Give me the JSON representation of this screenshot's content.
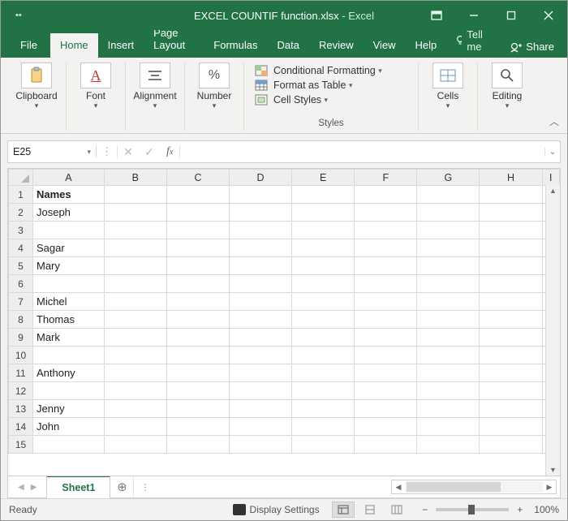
{
  "titlebar": {
    "document": "EXCEL COUNTIF function.xlsx",
    "app": "Excel"
  },
  "tabs": [
    "File",
    "Home",
    "Insert",
    "Page Layout",
    "Formulas",
    "Data",
    "Review",
    "View",
    "Help"
  ],
  "tell_me": "Tell me",
  "share": "Share",
  "ribbon": {
    "clipboard": {
      "label": "Clipboard"
    },
    "font": {
      "label": "Font"
    },
    "alignment": {
      "label": "Alignment"
    },
    "number": {
      "label": "Number"
    },
    "styles": {
      "conditional": "Conditional Formatting",
      "table": "Format as Table",
      "cell": "Cell Styles",
      "group_label": "Styles"
    },
    "cells": {
      "label": "Cells"
    },
    "editing": {
      "label": "Editing"
    }
  },
  "formula_bar": {
    "cell_ref": "E25",
    "formula": ""
  },
  "grid": {
    "columns": [
      "A",
      "B",
      "C",
      "D",
      "E",
      "F",
      "G",
      "H",
      "I"
    ],
    "rows": [
      {
        "n": 1,
        "A": "Names",
        "bold": true
      },
      {
        "n": 2,
        "A": "Joseph"
      },
      {
        "n": 3,
        "A": ""
      },
      {
        "n": 4,
        "A": "Sagar"
      },
      {
        "n": 5,
        "A": "Mary"
      },
      {
        "n": 6,
        "A": ""
      },
      {
        "n": 7,
        "A": "Michel"
      },
      {
        "n": 8,
        "A": "Thomas"
      },
      {
        "n": 9,
        "A": "Mark"
      },
      {
        "n": 10,
        "A": ""
      },
      {
        "n": 11,
        "A": "Anthony"
      },
      {
        "n": 12,
        "A": ""
      },
      {
        "n": 13,
        "A": "Jenny"
      },
      {
        "n": 14,
        "A": "John"
      },
      {
        "n": 15,
        "A": ""
      }
    ]
  },
  "sheets": {
    "active": "Sheet1"
  },
  "statusbar": {
    "status": "Ready",
    "display_settings": "Display Settings",
    "zoom": "100%"
  }
}
